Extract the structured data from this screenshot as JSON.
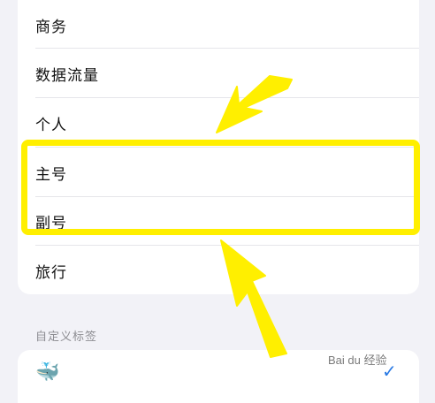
{
  "labels_list": {
    "items": [
      {
        "label": "商务"
      },
      {
        "label": "数据流量"
      },
      {
        "label": "个人"
      },
      {
        "label": "主号"
      },
      {
        "label": "副号"
      },
      {
        "label": "旅行"
      }
    ]
  },
  "custom_section": {
    "header": "自定义标签",
    "emoji_icon": "whale-emoji",
    "checkmark": "✓"
  },
  "annotation": {
    "highlight_color": "#ffef00",
    "arrow_color": "#ffef00"
  },
  "watermark": {
    "text": "Baidu 经验",
    "display": "Bai du 经验"
  }
}
